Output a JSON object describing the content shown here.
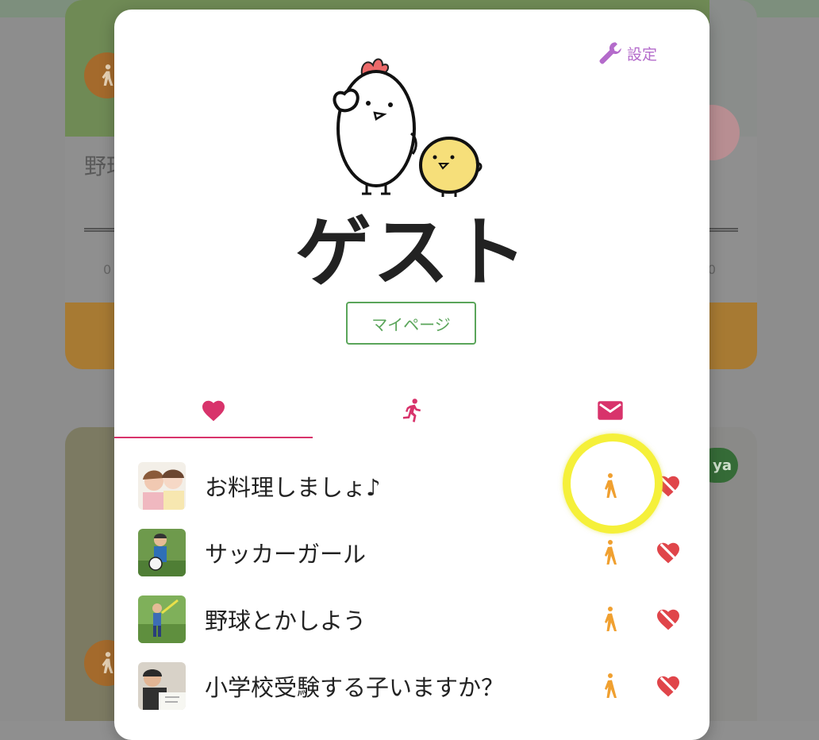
{
  "background": {
    "card1_title": "野球",
    "card1_left_num": "0",
    "card1_right_num": "0",
    "card2_badge": "ya"
  },
  "header": {
    "settings_label": "設定",
    "user_name": "ゲスト",
    "mypage_label": "マイページ"
  },
  "tabs": [
    {
      "icon": "heart-icon",
      "active": true
    },
    {
      "icon": "running-icon",
      "active": false
    },
    {
      "icon": "mail-icon",
      "active": false
    }
  ],
  "list": [
    {
      "title": "お料理しましょ♪",
      "thumb": "two-children-photo"
    },
    {
      "title": "サッカーガール",
      "thumb": "child-with-soccer-ball-photo"
    },
    {
      "title": "野球とかしよう",
      "thumb": "child-playing-baseball-photo"
    },
    {
      "title": "小学校受験する子いますか？",
      "thumb": "child-studying-photo"
    }
  ],
  "colors": {
    "accent_pink": "#d8336b",
    "walk_orange": "#f0a030",
    "unheart_red": "#e0454a",
    "settings_purple": "#b46bcb",
    "button_green": "#5aa55a",
    "highlight_yellow": "#f5f03a"
  }
}
